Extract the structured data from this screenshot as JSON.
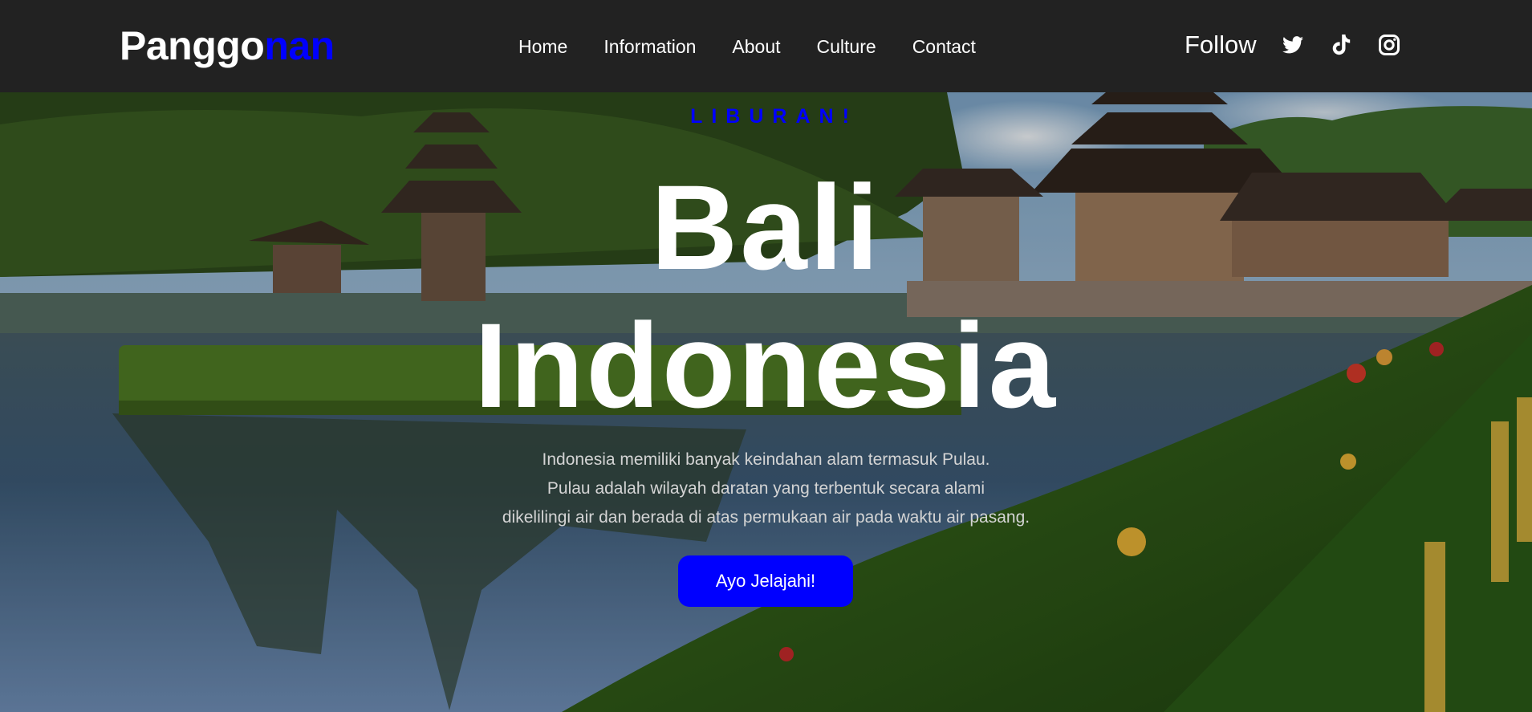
{
  "brand": {
    "name_main": "Panggo",
    "name_accent": "nan"
  },
  "nav": {
    "links": [
      "Home",
      "Information",
      "About",
      "Culture",
      "Contact"
    ]
  },
  "social": {
    "follow_label": "Follow",
    "icons": [
      "twitter-icon",
      "tiktok-icon",
      "instagram-icon"
    ]
  },
  "hero": {
    "eyebrow": "LIBURAN!",
    "title_line1": "Bali",
    "title_line2": "Indonesia",
    "description_line1": "Indonesia memiliki banyak keindahan alam termasuk Pulau.",
    "description_line2": "Pulau adalah wilayah daratan yang terbentuk secara alami",
    "description_line3": "dikelilingi air dan berada di atas permukaan air pada waktu air pasang.",
    "cta_label": "Ayo Jelajahi!"
  },
  "colors": {
    "navbar_bg": "#222222",
    "accent": "#0000ff",
    "text": "#ffffff"
  }
}
